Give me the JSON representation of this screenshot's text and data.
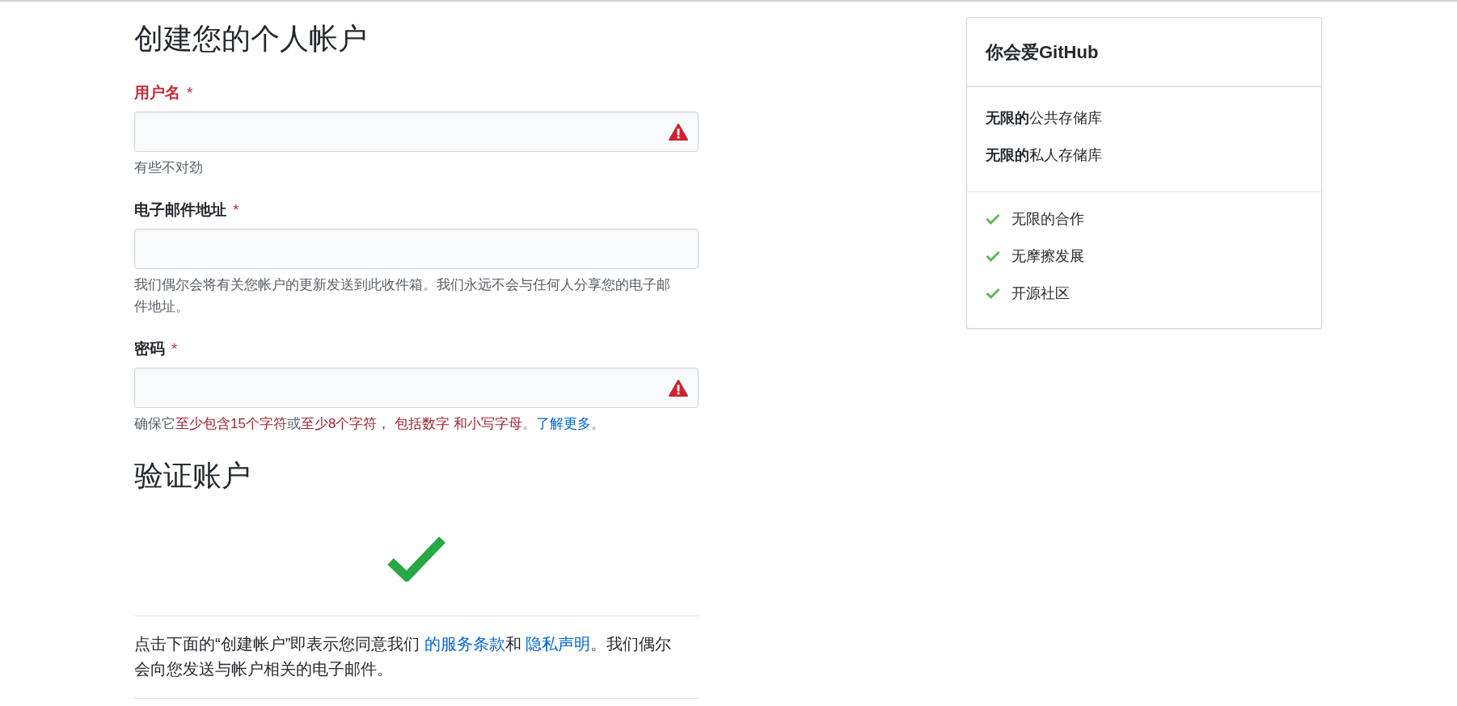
{
  "signup": {
    "heading": "创建您的个人帐户",
    "fields": [
      {
        "label": "用户名",
        "required_mark": "*",
        "label_error": true,
        "warning_icon": true,
        "hint": [
          {
            "kind": "plain",
            "text": "有些不对劲"
          }
        ]
      },
      {
        "label": "电子邮件地址",
        "required_mark": "*",
        "label_error": false,
        "warning_icon": false,
        "hint": [
          {
            "kind": "plain",
            "text": "我们偶尔会将有关您帐户的更新发送到此收件箱。我们永远不会与任何人分享您的电子邮件地址。"
          }
        ]
      },
      {
        "label": "密码",
        "required_mark": "*",
        "label_error": false,
        "warning_icon": true,
        "hint": [
          {
            "kind": "plain",
            "text": "确保它"
          },
          {
            "kind": "warning",
            "text": "至少包含15个字符"
          },
          {
            "kind": "plain",
            "text": "或"
          },
          {
            "kind": "warning",
            "text": "至少8个字符， 包括数字 和小写字母"
          },
          {
            "kind": "plain",
            "text": "。"
          },
          {
            "kind": "link",
            "text": "了解更多"
          },
          {
            "kind": "plain",
            "text": "。"
          }
        ]
      }
    ],
    "verify_heading": "验证账户",
    "terms": [
      {
        "kind": "plain",
        "text": "点击下面的“创建帐户”即表示您同意我们 "
      },
      {
        "kind": "link",
        "text": "的服务条款"
      },
      {
        "kind": "plain",
        "text": "和 "
      },
      {
        "kind": "link",
        "text": "隐私声明"
      },
      {
        "kind": "plain",
        "text": "。我们偶尔会向您发送与帐户相关的电子邮件。"
      }
    ]
  },
  "card": {
    "title": "你会爱GitHub",
    "plans": [
      "**无限的**公共存储库",
      "**无限的**私人存储库"
    ],
    "features": [
      "无限的合作",
      "无摩擦发展",
      "开源社区"
    ]
  }
}
